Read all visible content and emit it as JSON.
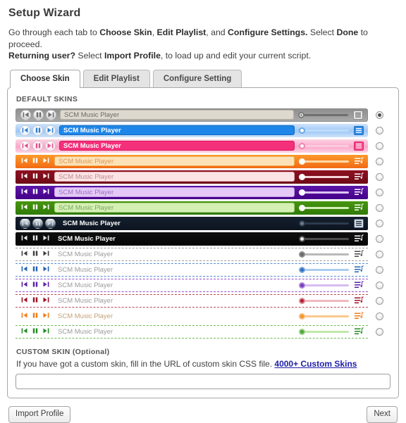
{
  "header": {
    "title": "Setup Wizard",
    "intro_line1_pre": "Go through each tab to ",
    "intro_b1": "Choose Skin",
    "intro_mid1": ", ",
    "intro_b2": "Edit Playlist",
    "intro_mid2": ", and ",
    "intro_b3": "Configure Settings.",
    "intro_mid3": " Select ",
    "intro_b4": "Done",
    "intro_end1": " to proceed.",
    "intro_b5": "Returning user?",
    "intro_mid4": " Select ",
    "intro_b6": "Import Profile",
    "intro_end2": ", to load up and edit your current script."
  },
  "tabs": [
    {
      "label": "Choose Skin",
      "active": true
    },
    {
      "label": "Edit Playlist",
      "active": false
    },
    {
      "label": "Configure Setting",
      "active": false
    }
  ],
  "panel": {
    "default_skins_label": "DEFAULT SKINS",
    "player_title": "SCM Music Player",
    "custom_skin_label": "CUSTOM SKIN (Optional)",
    "custom_skin_desc": "If you have got a custom skin, fill in the URL of custom skin CSS file.",
    "custom_skin_link": "4000+ Custom Skins",
    "url_value": "",
    "url_placeholder": ""
  },
  "footer": {
    "import_label": "Import Profile",
    "next_label": "Next"
  },
  "icons": {
    "prev": "prev-track-icon",
    "pause": "pause-icon",
    "next": "next-track-icon",
    "playlist": "playlist-icon",
    "volume": "volume-slider"
  },
  "skins": [
    {
      "id": "gray",
      "name": "Gray Default",
      "selected": true,
      "style": "classic",
      "bar": "#a9a9a9",
      "bar2": "#8f8f8f",
      "title_bg": "#ded9cf",
      "title_color": "#6e6a62",
      "title_border": "#b9b3a7",
      "btn_bg": "#cfcfcf",
      "btn_fg": "#6b6b6b",
      "track": "#6f6f6f",
      "knob": "#f2f2f2",
      "knob_border": "#7a7a7a",
      "knob_dot": "#555555",
      "pl_bg": "#e8e8e8",
      "pl_fg": "#5a5a5a",
      "pl_border": "#8d8d8d"
    },
    {
      "id": "blue",
      "name": "Blue",
      "selected": false,
      "style": "glossy",
      "bar": "#9ec7f5",
      "bar2": "#cfe3fb",
      "title_bg": "#1e86e8",
      "title_color": "#ffffff",
      "title_border": "#1268bf",
      "btn_bg": "#e9f3fd",
      "btn_fg": "#2f7fd0",
      "track": "#bcdcfb",
      "knob": "#ffffff",
      "knob_border": "#6aa8e4",
      "knob_dot": "",
      "pl_bg": "#2f8ce8",
      "pl_fg": "#ffffff",
      "pl_border": "#1f6fc0"
    },
    {
      "id": "pink",
      "name": "Pink",
      "selected": false,
      "style": "glossy",
      "bar": "#fba7c8",
      "bar2": "#fdd3e3",
      "title_bg": "#f5307b",
      "title_color": "#ffffff",
      "title_border": "#d21a60",
      "btn_bg": "#fde9f1",
      "btn_fg": "#e8518c",
      "track": "#fbcadd",
      "knob": "#ffffff",
      "knob_border": "#f082ae",
      "knob_dot": "",
      "pl_bg": "#f6468a",
      "pl_fg": "#ffffff",
      "pl_border": "#d42a6e"
    },
    {
      "id": "orange",
      "name": "Orange",
      "selected": false,
      "style": "flat",
      "bar": "#f26a14",
      "bar2": "#fb9a2c",
      "title_bg": "#fde2b8",
      "title_color": "#d99a56",
      "title_border": "#f0b35c",
      "btn_bg": "",
      "btn_fg": "#ffffff",
      "track": "#ffd9a8",
      "knob": "#ffffff",
      "knob_border": "#ffffff",
      "knob_dot": "",
      "pl_bg": "",
      "pl_fg": "#ffffff",
      "pl_border": ""
    },
    {
      "id": "darkred",
      "name": "Dark Red",
      "selected": false,
      "style": "flat",
      "bar": "#6d0b16",
      "bar2": "#8e1020",
      "title_bg": "#fbe3e5",
      "title_color": "#c08d92",
      "title_border": "#e2b3b7",
      "btn_bg": "",
      "btn_fg": "#ffffff",
      "track": "#f6d3d6",
      "knob": "#ffffff",
      "knob_border": "#ffffff",
      "knob_dot": "",
      "pl_bg": "",
      "pl_fg": "#ffffff",
      "pl_border": ""
    },
    {
      "id": "purple",
      "name": "Purple",
      "selected": false,
      "style": "flat",
      "bar": "#440089",
      "bar2": "#5c17a7",
      "title_bg": "#e4c9f7",
      "title_color": "#9a72bd",
      "title_border": "#c69ae2",
      "btn_bg": "",
      "btn_fg": "#ffffff",
      "track": "#ddc4f3",
      "knob": "#ffffff",
      "knob_border": "#ffffff",
      "knob_dot": "",
      "pl_bg": "",
      "pl_fg": "#ffffff",
      "pl_border": ""
    },
    {
      "id": "green",
      "name": "Green",
      "selected": false,
      "style": "flat",
      "bar": "#2f7a06",
      "bar2": "#47960f",
      "title_bg": "#d4f0b2",
      "title_color": "#7ea765",
      "title_border": "#a8d184",
      "btn_bg": "",
      "btn_fg": "#ffffff",
      "track": "#d6efb8",
      "knob": "#ffffff",
      "knob_border": "#ffffff",
      "knob_dot": "",
      "pl_bg": "",
      "pl_fg": "#ffffff",
      "pl_border": ""
    },
    {
      "id": "navy",
      "name": "Dark Navy",
      "selected": false,
      "style": "dark",
      "bar": "#0c1420",
      "bar2": "#16202e",
      "title_bg": "transparent",
      "title_color": "#ffffff",
      "title_border": "",
      "btn_bg": "#2a3a4d",
      "btn_fg": "#c9d6e4",
      "track": "#2c3b4c",
      "knob": "#6d7d8d",
      "knob_border": "#2c3b4c",
      "knob_dot": "",
      "pl_bg": "#cfdae6",
      "pl_fg": "#1d2a38",
      "pl_border": "#4e6072"
    },
    {
      "id": "black",
      "name": "Black",
      "selected": false,
      "style": "dark",
      "bar": "#050505",
      "bar2": "#101010",
      "title_bg": "transparent",
      "title_color": "#ffffff",
      "title_border": "",
      "btn_bg": "",
      "btn_fg": "#e8e8e8",
      "track": "#4b4b4b",
      "knob": "#e6e6e6",
      "knob_border": "#4b4b4b",
      "knob_dot": "",
      "pl_bg": "",
      "pl_fg": "#ffffff",
      "pl_border": ""
    },
    {
      "id": "light-gray",
      "name": "Light Gray",
      "selected": false,
      "style": "dotted",
      "bar": "#ffffff",
      "bar2": "#ffffff",
      "title_bg": "transparent",
      "title_color": "#9a9a9a",
      "title_border": "",
      "btn_bg": "",
      "btn_fg": "#3f3f3f",
      "track": "#b9b9b9",
      "knob": "#6a6a6a",
      "knob_border": "#8e8e8e",
      "knob_dot": "",
      "pl_bg": "",
      "pl_fg": "#4a4a4a",
      "pl_border": "",
      "dot": "#9b9b9b"
    },
    {
      "id": "light-blue",
      "name": "Light Blue",
      "selected": false,
      "style": "dotted",
      "bar": "#ffffff",
      "bar2": "#ffffff",
      "title_bg": "transparent",
      "title_color": "#9a9a9a",
      "title_border": "",
      "btn_bg": "",
      "btn_fg": "#2363b3",
      "track": "#aacdf0",
      "knob": "#2b6fc4",
      "knob_border": "#7fa9d8",
      "knob_dot": "",
      "pl_bg": "",
      "pl_fg": "#2363b3",
      "pl_border": "",
      "dot": "#4f8bd0"
    },
    {
      "id": "light-purple",
      "name": "Light Purple",
      "selected": false,
      "style": "dotted",
      "bar": "#ffffff",
      "bar2": "#ffffff",
      "title_bg": "transparent",
      "title_color": "#9a9a9a",
      "title_border": "",
      "btn_bg": "",
      "btn_fg": "#5b20a8",
      "track": "#d7bcf0",
      "knob": "#7a39c0",
      "knob_border": "#ab84d8",
      "knob_dot": "",
      "pl_bg": "",
      "pl_fg": "#5b20a8",
      "pl_border": "",
      "dot": "#8b4fc6"
    },
    {
      "id": "light-red",
      "name": "Light Red",
      "selected": false,
      "style": "dotted",
      "bar": "#ffffff",
      "bar2": "#ffffff",
      "title_bg": "transparent",
      "title_color": "#9a9a9a",
      "title_border": "",
      "btn_bg": "",
      "btn_fg": "#9b1024",
      "track": "#f0b8c0",
      "knob": "#b51d33",
      "knob_border": "#d88a95",
      "knob_dot": "",
      "pl_bg": "",
      "pl_fg": "#9b1024",
      "pl_border": "",
      "dot": "#b94a5a"
    },
    {
      "id": "light-orange",
      "name": "Light Orange",
      "selected": false,
      "style": "dotted",
      "bar": "#ffffff",
      "bar2": "#ffffff",
      "title_bg": "transparent",
      "title_color": "#c4a277",
      "title_border": "",
      "btn_bg": "",
      "btn_fg": "#f07a18",
      "track": "#fbc98d",
      "knob": "#f79420",
      "knob_border": "#f5bb7d",
      "knob_dot": "",
      "pl_bg": "",
      "pl_fg": "#f07a18",
      "pl_border": "",
      "dot": "#f0a košel"
    },
    {
      "id": "light-green",
      "name": "Light Green",
      "selected": false,
      "style": "dotted",
      "bar": "#ffffff",
      "bar2": "#ffffff",
      "title_bg": "transparent",
      "title_color": "#9a9a9a",
      "title_border": "",
      "btn_bg": "",
      "btn_fg": "#1f8a1f",
      "track": "#bfe8a8",
      "knob": "#4aa832",
      "knob_border": "#9bcd84",
      "knob_dot": "",
      "pl_bg": "",
      "pl_fg": "#1f8a1f",
      "pl_border": "",
      "dot": "#6cba52"
    }
  ]
}
